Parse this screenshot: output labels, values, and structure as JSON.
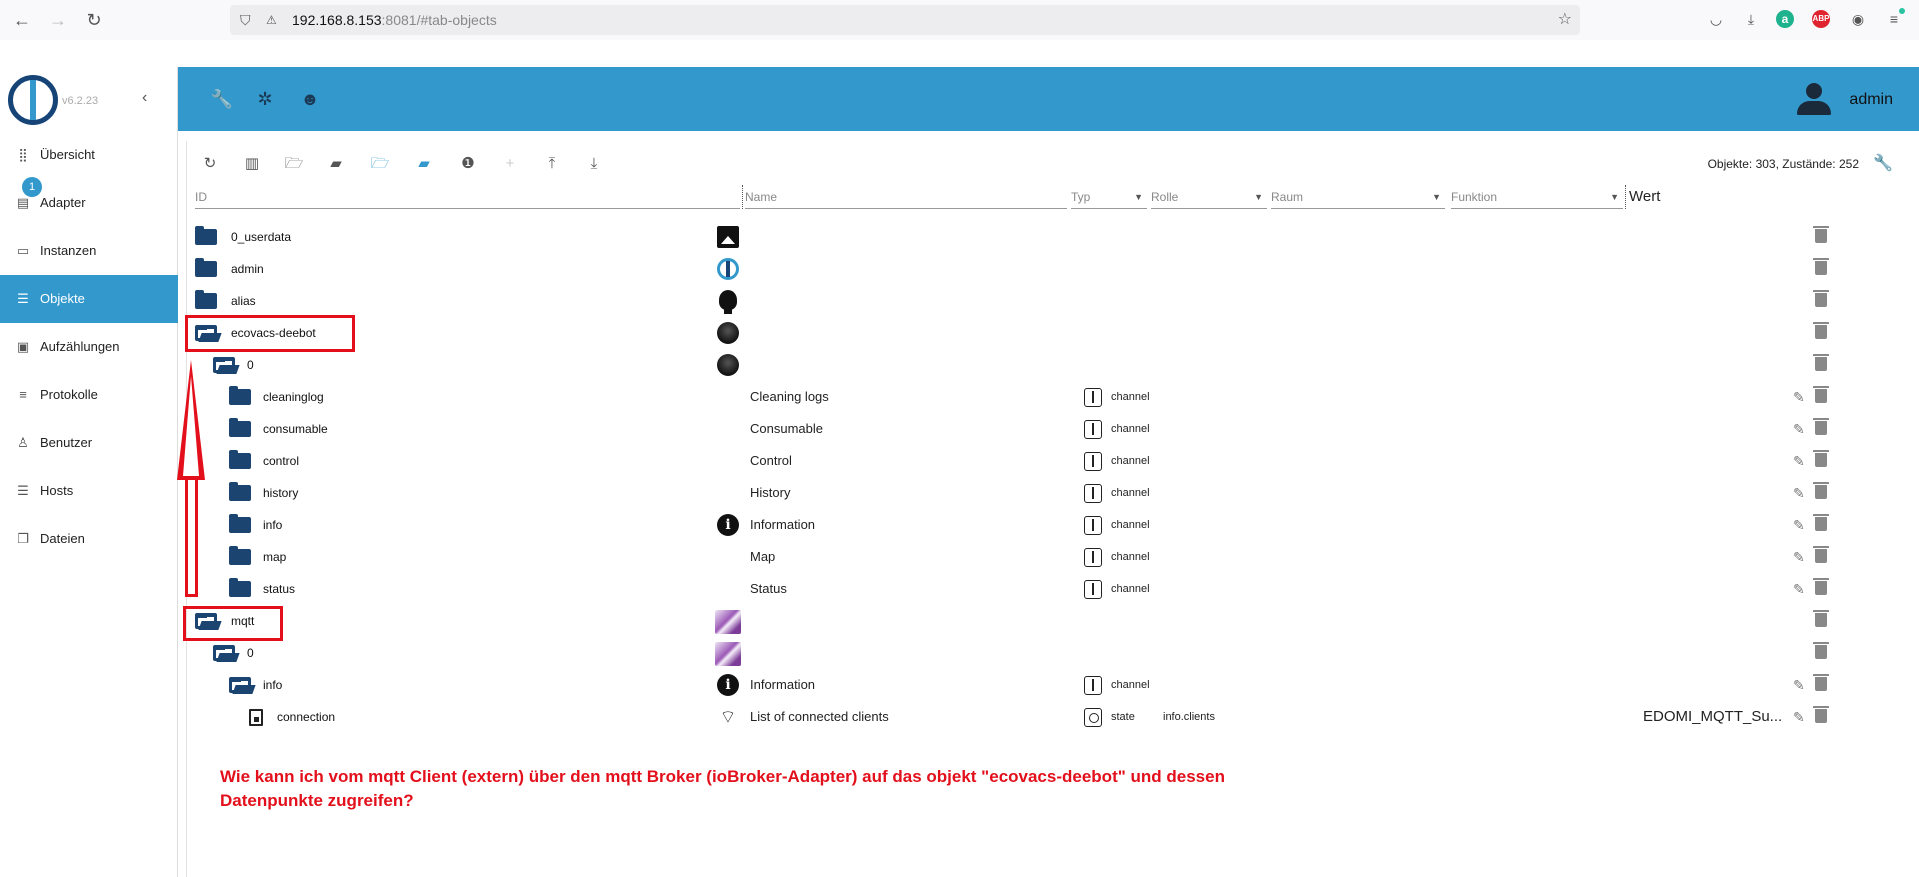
{
  "browser": {
    "url_host": "192.168.8.153",
    "url_rest": ":8081/#tab-objects"
  },
  "sidebar": {
    "version": "v6.2.23",
    "items": [
      {
        "label": "Übersicht",
        "icon": "apps-icon"
      },
      {
        "label": "Adapter",
        "icon": "store-icon",
        "badge": "1"
      },
      {
        "label": "Instanzen",
        "icon": "list-icon"
      },
      {
        "label": "Objekte",
        "icon": "list-bullets-icon",
        "active": true
      },
      {
        "label": "Aufzählungen",
        "icon": "enum-icon"
      },
      {
        "label": "Protokolle",
        "icon": "menu-icon"
      },
      {
        "label": "Benutzer",
        "icon": "person-icon"
      },
      {
        "label": "Hosts",
        "icon": "list-icon"
      },
      {
        "label": "Dateien",
        "icon": "files-icon"
      }
    ]
  },
  "appbar": {
    "user": "admin"
  },
  "objects": {
    "counts": "Objekte: 303, Zustände: 252",
    "filters": {
      "id": "ID",
      "name": "Name",
      "typ": "Typ",
      "rolle": "Rolle",
      "raum": "Raum",
      "funktion": "Funktion"
    },
    "wert_header": "Wert",
    "rows": [
      {
        "id": "0_userdata",
        "name": "",
        "typ": "",
        "rolle": "",
        "wert": ""
      },
      {
        "id": "admin",
        "name": "",
        "typ": "",
        "rolle": "",
        "wert": ""
      },
      {
        "id": "alias",
        "name": "",
        "typ": "",
        "rolle": "",
        "wert": ""
      },
      {
        "id": "ecovacs-deebot",
        "name": "",
        "typ": "",
        "rolle": "",
        "wert": ""
      },
      {
        "id": "0",
        "name": "",
        "typ": "",
        "rolle": "",
        "wert": ""
      },
      {
        "id": "cleaninglog",
        "name": "Cleaning logs",
        "typ": "channel",
        "rolle": "",
        "wert": ""
      },
      {
        "id": "consumable",
        "name": "Consumable",
        "typ": "channel",
        "rolle": "",
        "wert": ""
      },
      {
        "id": "control",
        "name": "Control",
        "typ": "channel",
        "rolle": "",
        "wert": ""
      },
      {
        "id": "history",
        "name": "History",
        "typ": "channel",
        "rolle": "",
        "wert": ""
      },
      {
        "id": "info",
        "name": "Information",
        "typ": "channel",
        "rolle": "",
        "wert": ""
      },
      {
        "id": "map",
        "name": "Map",
        "typ": "channel",
        "rolle": "",
        "wert": ""
      },
      {
        "id": "status",
        "name": "Status",
        "typ": "channel",
        "rolle": "",
        "wert": ""
      },
      {
        "id": "mqtt",
        "name": "",
        "typ": "",
        "rolle": "",
        "wert": ""
      },
      {
        "id": "0",
        "name": "",
        "typ": "",
        "rolle": "",
        "wert": ""
      },
      {
        "id": "info",
        "name": "Information",
        "typ": "channel",
        "rolle": "",
        "wert": ""
      },
      {
        "id": "connection",
        "name": "List of connected clients",
        "typ": "state",
        "rolle": "info.clients",
        "wert": "EDOMI_MQTT_Su..."
      }
    ]
  },
  "annotation": {
    "question_line1": "Wie kann ich vom mqtt Client (extern) über den mqtt Broker (ioBroker-Adapter) auf das objekt \"ecovacs-deebot\" und dessen",
    "question_line2": "Datenpunkte zugreifen?"
  },
  "colors": {
    "accent": "#3399cc",
    "folder": "#1b4470",
    "annotation": "#e3101c"
  }
}
